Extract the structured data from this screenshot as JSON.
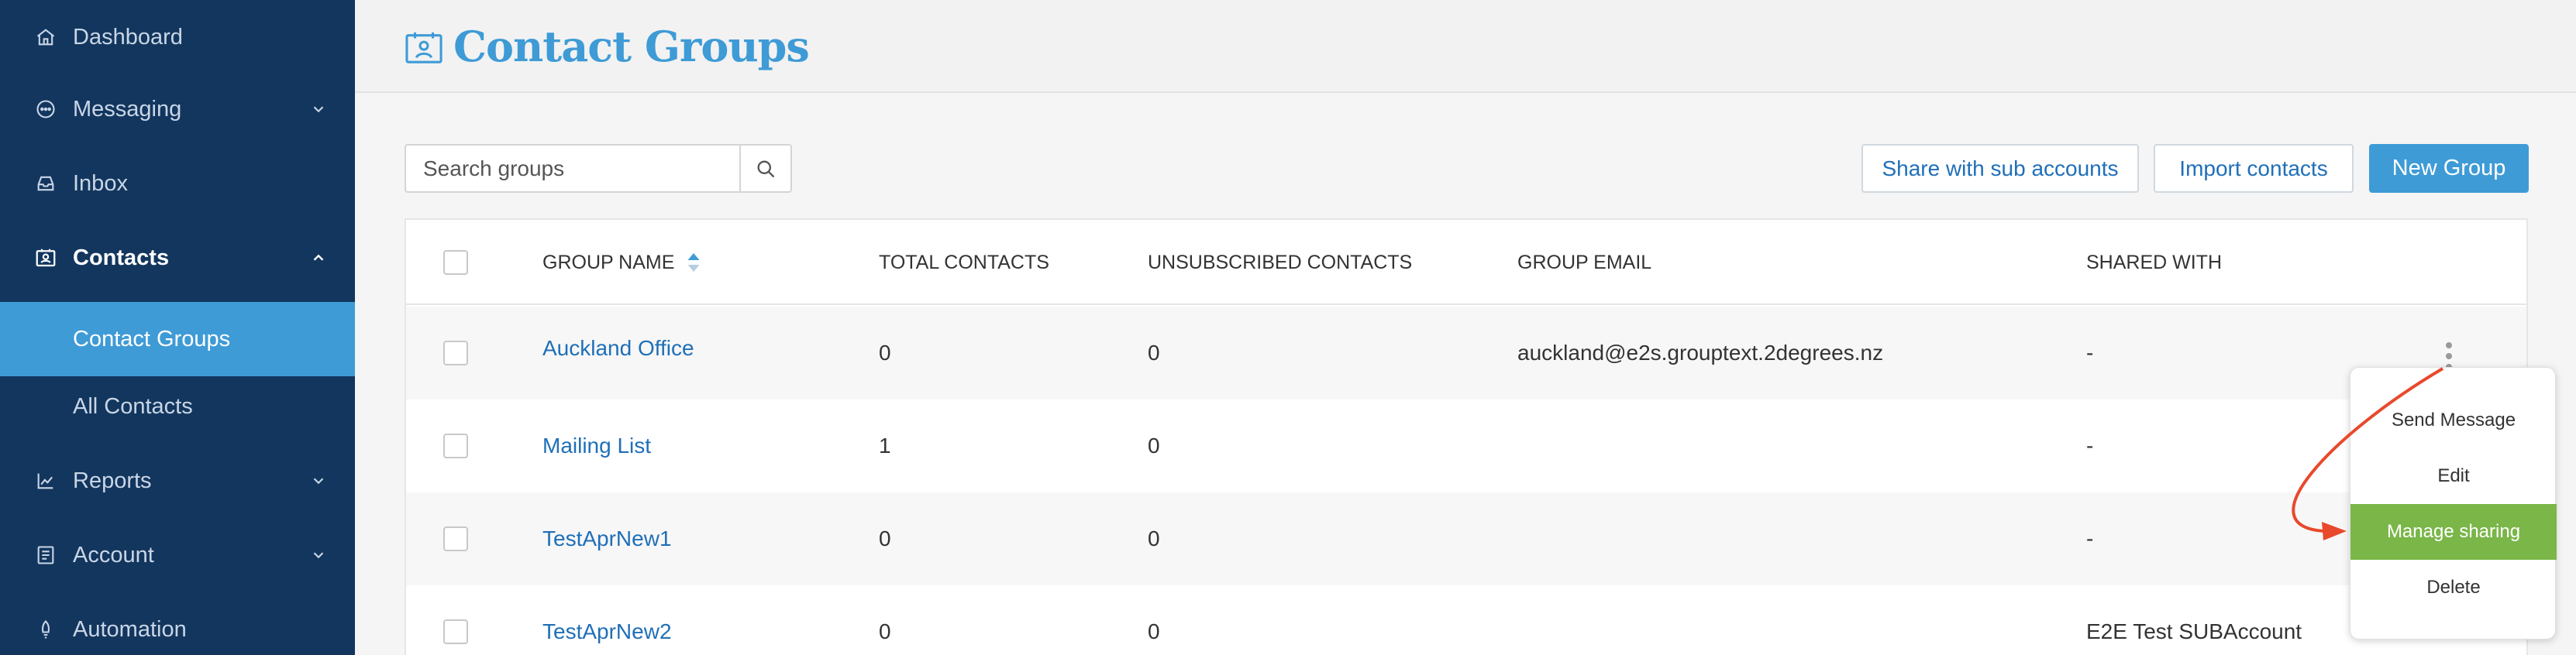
{
  "sidebar": {
    "items": [
      {
        "label": "Dashboard",
        "icon": "home-icon"
      },
      {
        "label": "Messaging",
        "icon": "chat-icon"
      },
      {
        "label": "Inbox",
        "icon": "inbox-icon"
      },
      {
        "label": "Contacts",
        "icon": "contacts-icon"
      },
      {
        "label": "Contact Groups"
      },
      {
        "label": "All Contacts"
      },
      {
        "label": "Reports",
        "icon": "chart-icon"
      },
      {
        "label": "Account",
        "icon": "account-icon"
      },
      {
        "label": "Automation",
        "icon": "automation-icon"
      }
    ]
  },
  "header": {
    "title": "Contact Groups",
    "icon": "contact-card-icon"
  },
  "toolbar": {
    "search_placeholder": "Search groups",
    "share_label": "Share with sub accounts",
    "import_label": "Import contacts",
    "new_group_label": "New Group"
  },
  "table": {
    "columns": [
      "GROUP NAME",
      "TOTAL CONTACTS",
      "UNSUBSCRIBED CONTACTS",
      "GROUP EMAIL",
      "SHARED WITH"
    ],
    "rows": [
      {
        "name": "Auckland Office",
        "total": "0",
        "unsubscribed": "0",
        "email": "auckland@e2s.grouptext.2degrees.nz",
        "shared": "-"
      },
      {
        "name": "Mailing List",
        "total": "1",
        "unsubscribed": "0",
        "email": "",
        "shared": "-"
      },
      {
        "name": "TestAprNew1",
        "total": "0",
        "unsubscribed": "0",
        "email": "",
        "shared": "-"
      },
      {
        "name": "TestAprNew2",
        "total": "0",
        "unsubscribed": "0",
        "email": "",
        "shared": "E2E Test SUBAccount"
      }
    ]
  },
  "menu": {
    "items": [
      "Send Message",
      "Edit",
      "Manage sharing",
      "Delete"
    ],
    "highlighted": "Manage sharing"
  },
  "colors": {
    "sidebar_bg": "#13365e",
    "accent": "#3e9bd6",
    "link": "#1f6fb8",
    "highlight": "#7ab648",
    "annotation_arrow": "#e8492c"
  }
}
